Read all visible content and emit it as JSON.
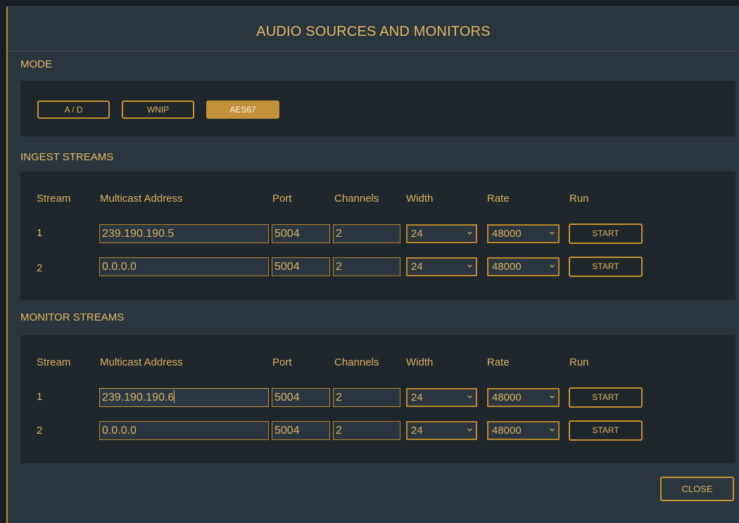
{
  "dialog": {
    "title": "AUDIO SOURCES AND MONITORS",
    "close_label": "CLOSE"
  },
  "mode": {
    "label": "MODE",
    "buttons": [
      {
        "label": "A / D",
        "active": false
      },
      {
        "label": "WNIP",
        "active": false
      },
      {
        "label": "AES67",
        "active": true
      }
    ]
  },
  "columns": [
    "Stream",
    "Multicast Address",
    "Port",
    "Channels",
    "Width",
    "Rate",
    "Run"
  ],
  "ingest": {
    "label": "INGEST STREAMS",
    "rows": [
      {
        "stream": "1",
        "address": "239.190.190.5",
        "port": "5004",
        "channels": "2",
        "width": "24",
        "rate": "48000",
        "run": "START"
      },
      {
        "stream": "2",
        "address": "0.0.0.0",
        "port": "5004",
        "channels": "2",
        "width": "24",
        "rate": "48000",
        "run": "START"
      }
    ]
  },
  "monitor": {
    "label": "MONITOR STREAMS",
    "rows": [
      {
        "stream": "1",
        "address": "239.190.190.6",
        "port": "5004",
        "channels": "2",
        "width": "24",
        "rate": "48000",
        "run": "START"
      },
      {
        "stream": "2",
        "address": "0.0.0.0",
        "port": "5004",
        "channels": "2",
        "width": "24",
        "rate": "48000",
        "run": "START"
      }
    ]
  },
  "colors": {
    "accent": "#c39332",
    "text": "#d8b262",
    "panel": "#1f262c",
    "dialog": "#2b353d"
  },
  "icons": {
    "select_arrow": "chevron-down-icon"
  }
}
